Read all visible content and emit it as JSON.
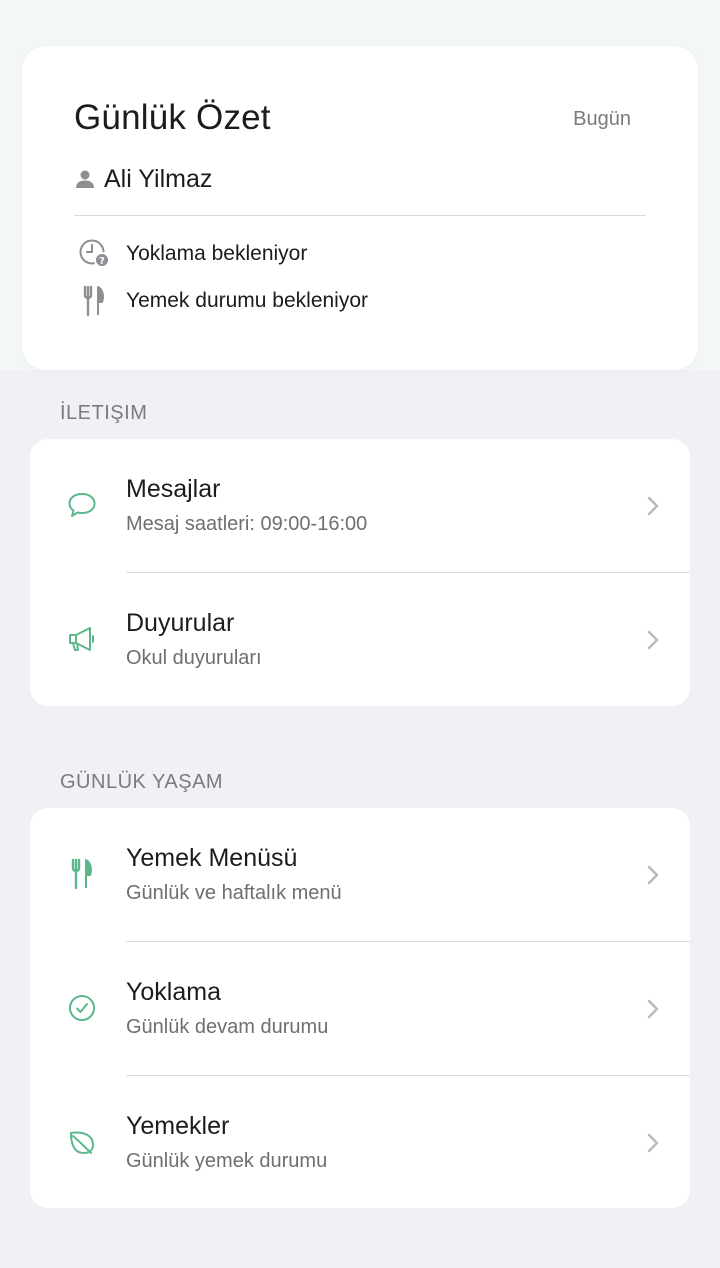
{
  "summary": {
    "title": "Günlük Özet",
    "date_label": "Bugün",
    "student_name": "Ali Yilmaz",
    "statuses": [
      {
        "icon": "clock-question-icon",
        "text": "Yoklama bekleniyor"
      },
      {
        "icon": "fork-knife-icon",
        "text": "Yemek durumu bekleniyor"
      }
    ]
  },
  "sections": [
    {
      "header": "İLETIŞIM",
      "items": [
        {
          "icon": "chat-bubble-icon",
          "title": "Mesajlar",
          "subtitle": "Mesaj saatleri: 09:00-16:00"
        },
        {
          "icon": "megaphone-icon",
          "title": "Duyurular",
          "subtitle": "Okul duyuruları"
        }
      ]
    },
    {
      "header": "GÜNLÜK YAŞAM",
      "items": [
        {
          "icon": "fork-knife-icon",
          "title": "Yemek Menüsü",
          "subtitle": "Günlük ve haftalık menü"
        },
        {
          "icon": "check-circle-icon",
          "title": "Yoklama",
          "subtitle": "Günlük devam durumu"
        },
        {
          "icon": "leaf-icon",
          "title": "Yemekler",
          "subtitle": "Günlük yemek durumu"
        }
      ]
    }
  ],
  "colors": {
    "accent": "#5cb88a",
    "muted_icon": "#8e8e93",
    "background": "#f1f1f5",
    "top_band": "#f3f8f4"
  }
}
